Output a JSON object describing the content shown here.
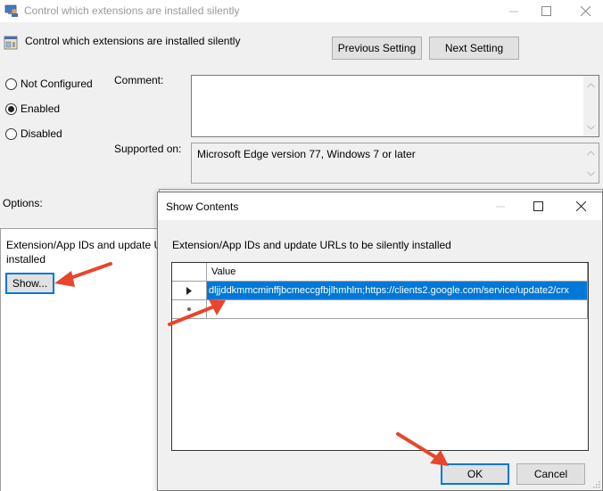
{
  "main_window": {
    "title": "Control which extensions are installed silently",
    "controls": [
      "minimize",
      "maximize",
      "close"
    ]
  },
  "policy": {
    "title": "Control which extensions are installed silently",
    "previous_setting_label": "Previous Setting",
    "next_setting_label": "Next Setting",
    "state_options": [
      {
        "label": "Not Configured",
        "selected": false
      },
      {
        "label": "Enabled",
        "selected": true
      },
      {
        "label": "Disabled",
        "selected": false
      }
    ],
    "comment_label": "Comment:",
    "comment_value": "",
    "supported_on_label": "Supported on:",
    "supported_on_value": "Microsoft Edge version 77, Windows 7 or later",
    "options_label": "Options:",
    "help_label": "Show",
    "option_description_line1": "Extension/App IDs and update URLs to be silently",
    "option_description_line2": "installed",
    "show_button_label": "Show..."
  },
  "dialog": {
    "title": "Show Contents",
    "description": "Extension/App IDs and update URLs to be silently installed",
    "grid": {
      "column_header": "Value",
      "rows": [
        {
          "indicator": "current-row",
          "value": "dljjddkmmcminffjbcmeccgfbjlhmhlm;https://clients2.google.com/service/update2/crx",
          "selected": true
        },
        {
          "indicator": "new-row",
          "value": "",
          "selected": false
        }
      ]
    },
    "ok_label": "OK",
    "cancel_label": "Cancel"
  },
  "annotations": {
    "arrow_color": "#e8452c",
    "arrows": [
      "points-to-show-button",
      "points-to-value-cell",
      "points-to-ok-button"
    ]
  },
  "colors": {
    "selection": "#0078d7",
    "focus_border": "#0078d7",
    "window_bg": "#f0f0f0"
  }
}
